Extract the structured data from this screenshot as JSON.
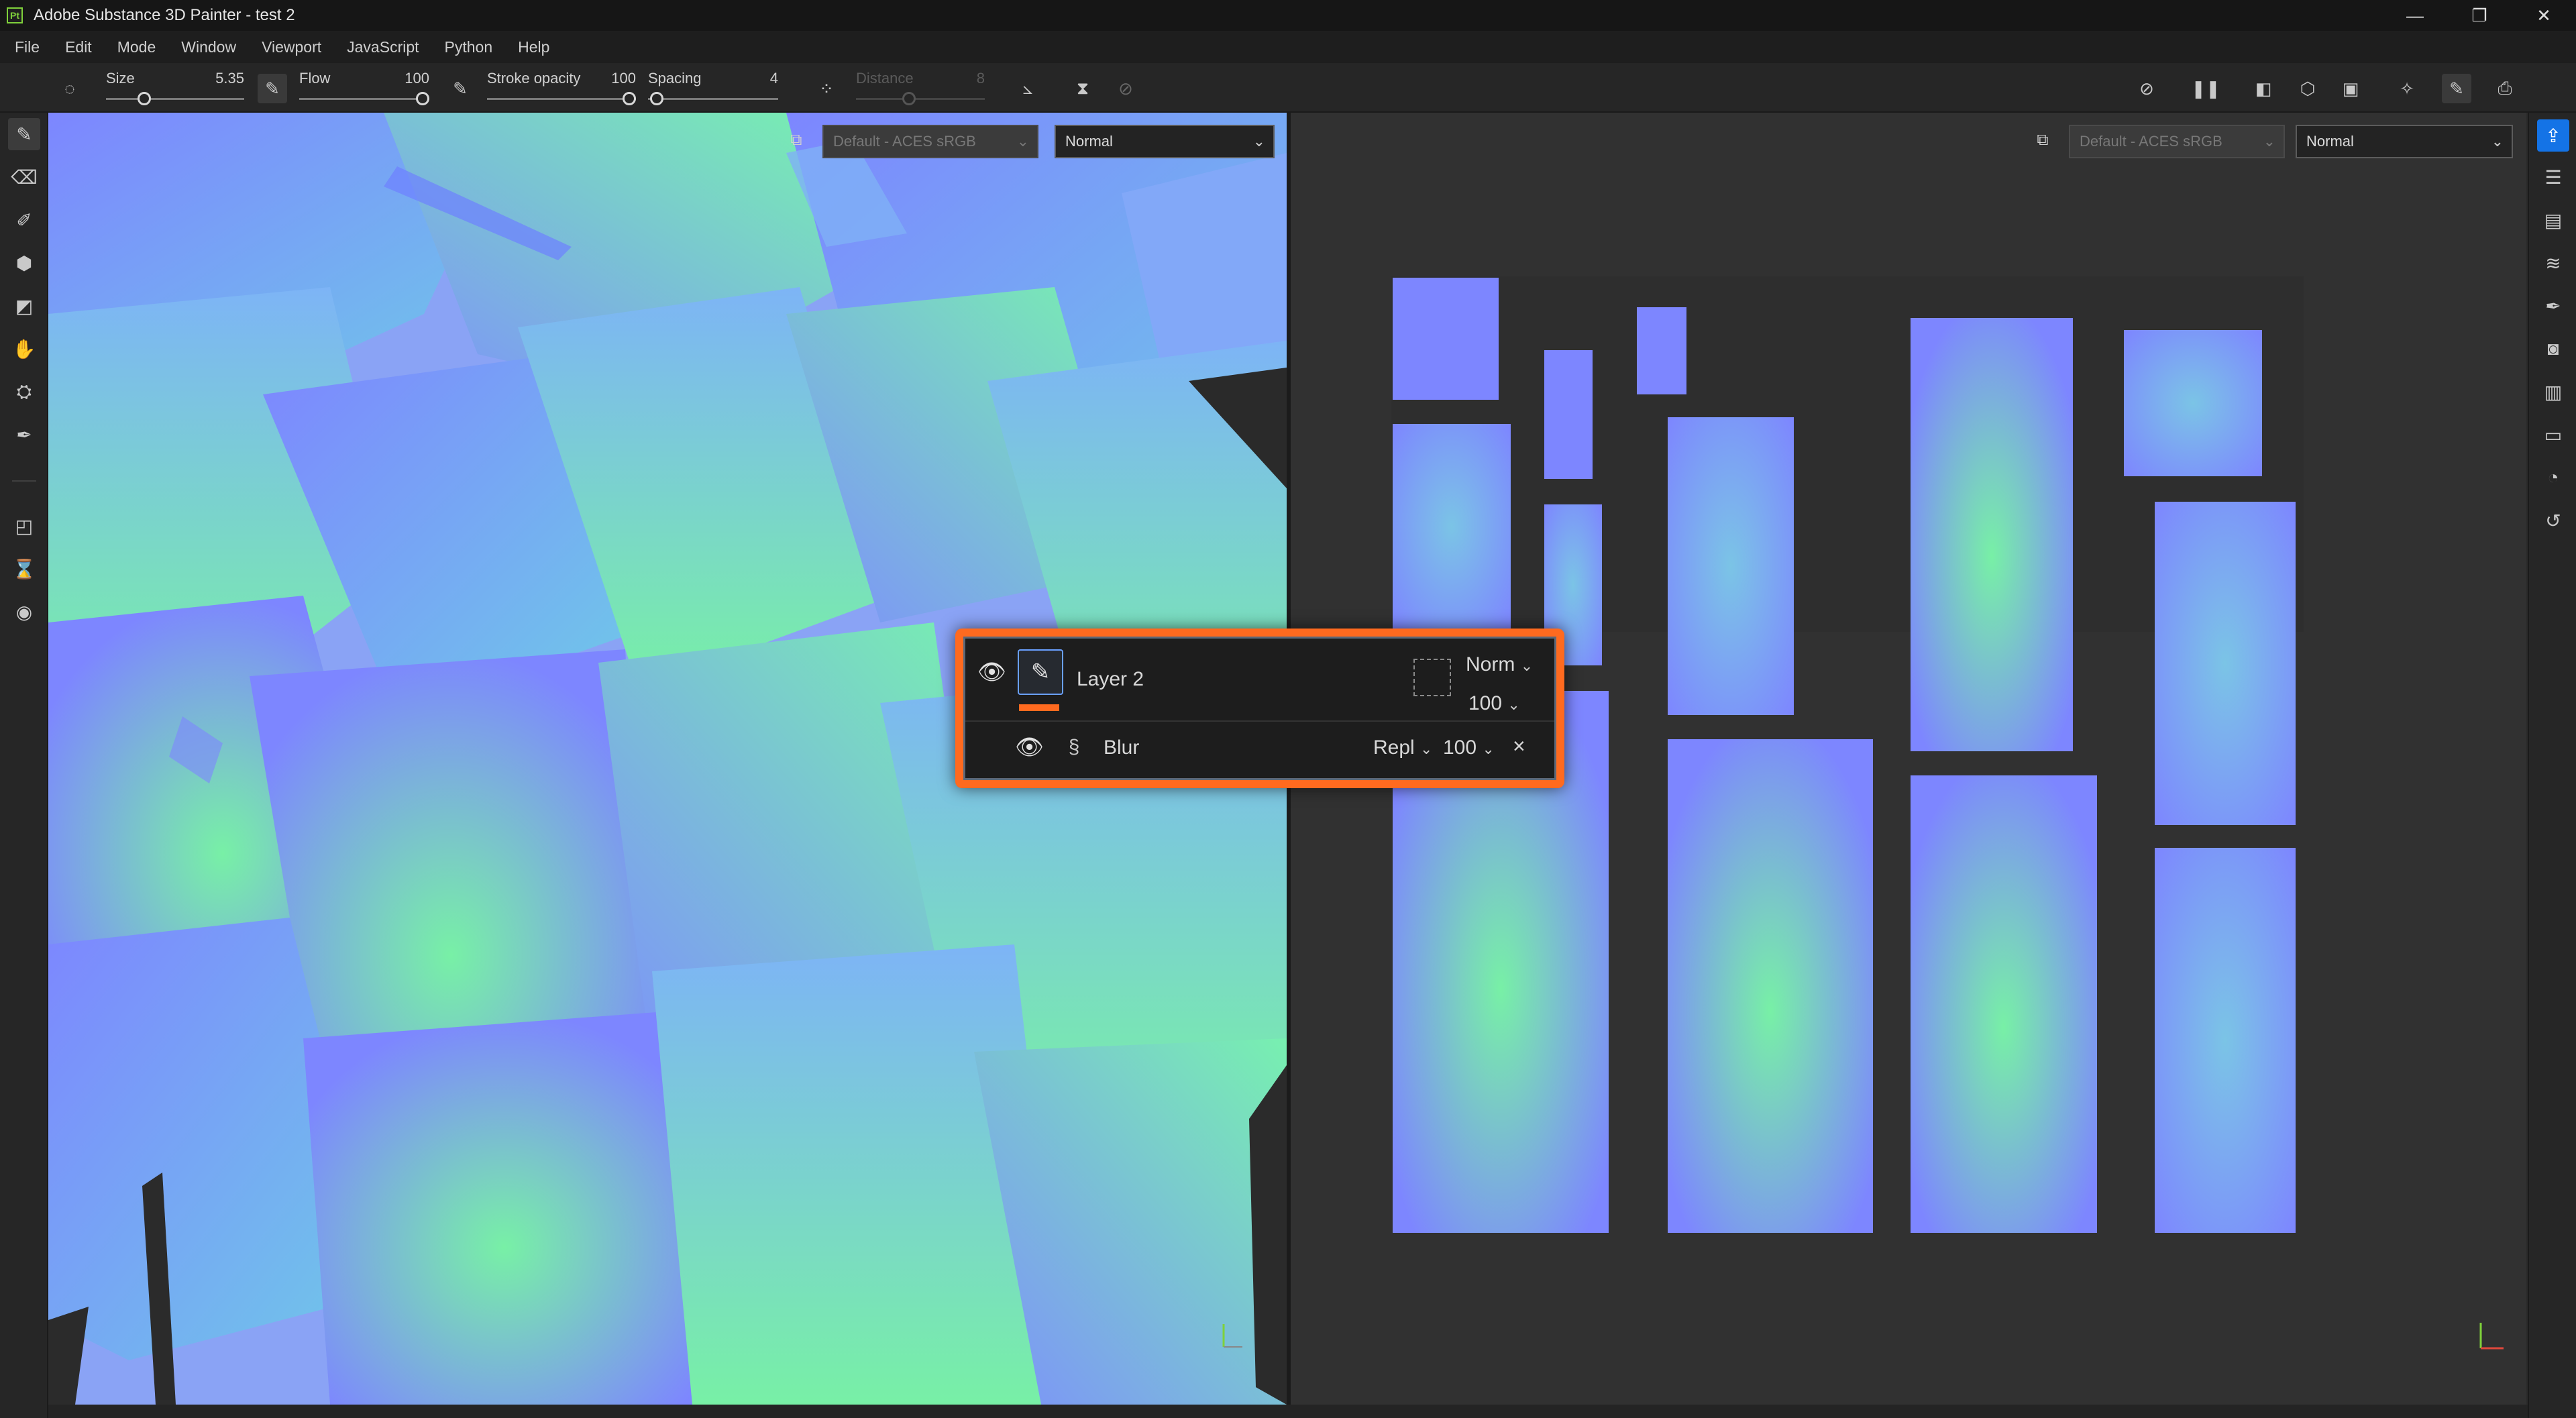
{
  "window": {
    "title": "Adobe Substance 3D Painter - test 2",
    "logo_text": "Pt",
    "controls": {
      "minimize": "—",
      "restore": "❐",
      "close": "✕"
    }
  },
  "menu": [
    "File",
    "Edit",
    "Mode",
    "Window",
    "Viewport",
    "JavaScript",
    "Python",
    "Help"
  ],
  "tool_options": {
    "size": {
      "label": "Size",
      "value": "5.35",
      "level": 0.25
    },
    "flow": {
      "label": "Flow",
      "value": "100",
      "level": 1.0
    },
    "stroke_opacity": {
      "label": "Stroke opacity",
      "value": "100",
      "level": 1.0
    },
    "spacing": {
      "label": "Spacing",
      "value": "4",
      "level": 0.02
    },
    "distance": {
      "label": "Distance",
      "value": "8",
      "level": 0.4,
      "disabled": true
    }
  },
  "viewport_3d": {
    "color_profile": "Default - ACES sRGB",
    "color_profile_disabled": true,
    "display_mode": "Normal"
  },
  "viewport_2d": {
    "color_profile": "Default - ACES sRGB",
    "color_profile_disabled": true,
    "display_mode": "Normal"
  },
  "layer_popup": {
    "layer_name": "Layer 2",
    "blend_mode": "Norm",
    "opacity": "100",
    "layer_color": "#ff6a1f",
    "effect": {
      "name": "Blur",
      "blend_mode": "Repl",
      "opacity": "100",
      "close": "×"
    }
  },
  "colors": {
    "accent": "#1473e6",
    "popup_border": "#ff6a1f",
    "uv_blue": "#7d86ff",
    "uv_green": "#78f0a6"
  },
  "icons": {
    "left_tools": [
      "paint-brush-icon",
      "eraser-icon",
      "projection-icon",
      "geometry-fill-icon",
      "polygon-fill-icon",
      "smudge-icon",
      "clone-icon",
      "color-picker-icon",
      "material-picker-icon",
      "bake-icon",
      "iray-icon"
    ],
    "right_panels": [
      "export-icon",
      "layers-icon",
      "texture-set-icon",
      "layer-stack-icon",
      "brush-settings-icon",
      "display-settings-icon",
      "properties-icon",
      "shelf-icon",
      "viewer-settings-icon",
      "history-icon"
    ]
  }
}
